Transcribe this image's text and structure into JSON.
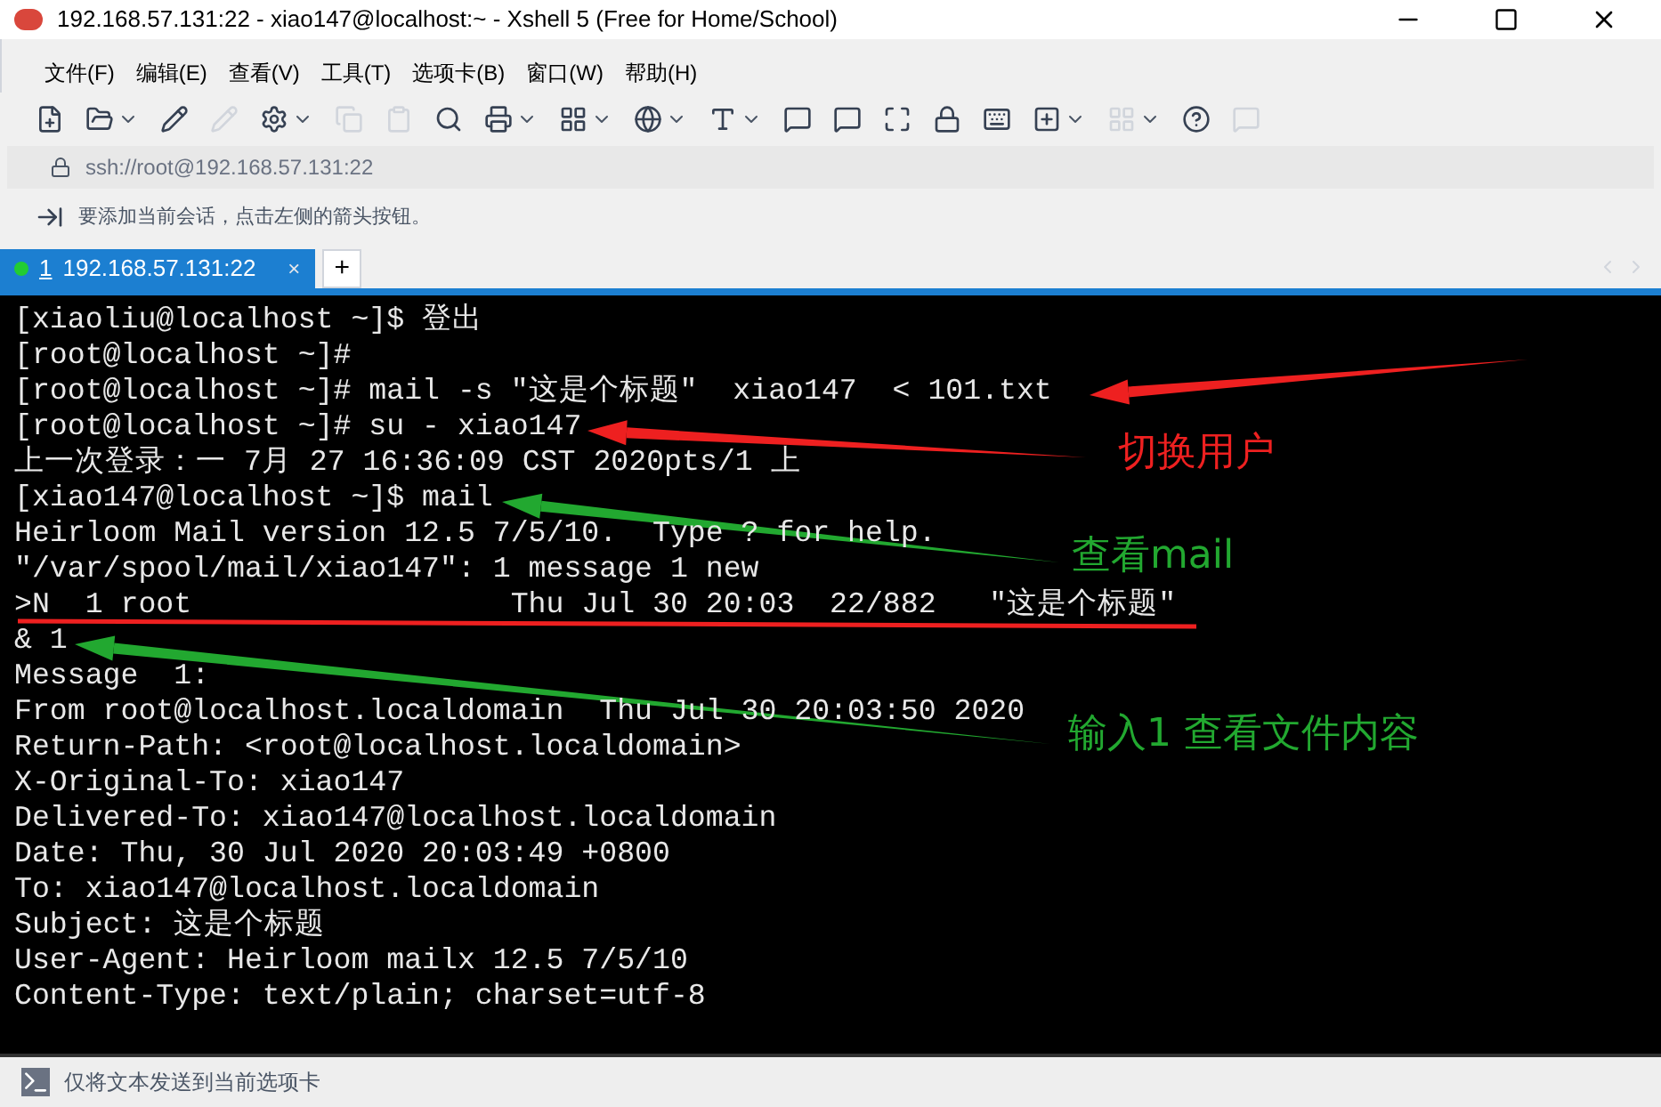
{
  "window": {
    "title": "192.168.57.131:22 - xiao147@localhost:~ - Xshell 5 (Free for Home/School)"
  },
  "menu": [
    "文件(F)",
    "编辑(E)",
    "查看(V)",
    "工具(T)",
    "选项卡(B)",
    "窗口(W)",
    "帮助(H)"
  ],
  "address": {
    "value": "ssh://root@192.168.57.131:22"
  },
  "hint": "要添加当前会话，点击左侧的箭头按钮。",
  "tabs": [
    {
      "number": "1",
      "label": "192.168.57.131:22",
      "selected": true,
      "connected": true,
      "close": "×"
    }
  ],
  "new_tab": "+",
  "terminal": {
    "lines": [
      "[xiaoliu@localhost ~]$ 登出",
      "[root@localhost ~]#",
      "[root@localhost ~]# mail -s \"这是个标题\"  xiao147  < 101.txt",
      "[root@localhost ~]# su - xiao147",
      "上一次登录：一 7月 27 16:36:09 CST 2020pts/1 上",
      "[xiao147@localhost ~]$ mail",
      "Heirloom Mail version 12.5 7/5/10.  Type ? for help.",
      "\"/var/spool/mail/xiao147\": 1 message 1 new",
      ">N  1 root                  Thu Jul 30 20:03  22/882   \"这是个标题\"",
      "& 1",
      "Message  1:",
      "From root@localhost.localdomain  Thu Jul 30 20:03:50 2020",
      "Return-Path: <root@localhost.localdomain>",
      "X-Original-To: xiao147",
      "Delivered-To: xiao147@localhost.localdomain",
      "Date: Thu, 30 Jul 2020 20:03:49 +0800",
      "To: xiao147@localhost.localdomain",
      "Subject: 这是个标题",
      "User-Agent: Heirloom mailx 12.5 7/5/10",
      "Content-Type: text/plain; charset=utf-8"
    ]
  },
  "annotations": [
    {
      "kind": "arrow",
      "color": "#ee2020"
    },
    {
      "kind": "arrow",
      "color": "#ee2020",
      "label": "切换用户"
    },
    {
      "kind": "arrow",
      "color": "#22a830",
      "label": "查看mail"
    },
    {
      "kind": "underline",
      "color": "#ee2020"
    },
    {
      "kind": "arrow",
      "color": "#22a830",
      "label": "输入1 查看文件内容"
    }
  ],
  "send_bar": {
    "text": "仅将文本发送到当前选项卡"
  }
}
